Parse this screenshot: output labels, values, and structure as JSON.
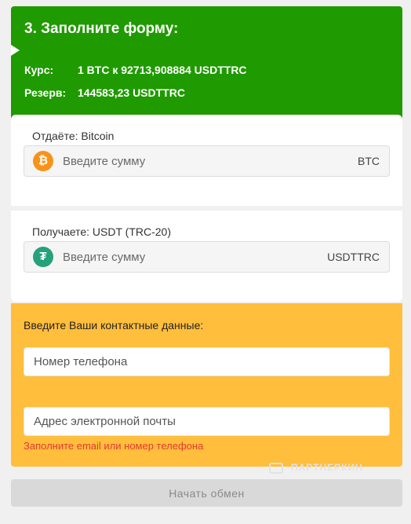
{
  "header": {
    "title": "3. Заполните форму:",
    "rate_label": "Курс:",
    "rate_value": "1 BTC к 92713,908884 USDTTRC",
    "reserve_label": "Резерв:",
    "reserve_value": "144583,23 USDTTRC"
  },
  "give": {
    "label": "Отдаёте: Bitcoin",
    "placeholder": "Введите сумму",
    "currency": "BTC",
    "icon": "bitcoin-icon",
    "icon_glyph": "₿",
    "icon_color": "#f7931a"
  },
  "get": {
    "label": "Получаете: USDT (TRC-20)",
    "placeholder": "Введите сумму",
    "currency": "USDTTRC",
    "icon": "tether-icon",
    "icon_glyph": "₮",
    "icon_color": "#26a17b"
  },
  "contact": {
    "title": "Введите Ваши контактные данные:",
    "phone_placeholder": "Номер телефона",
    "email_placeholder": "Адрес электронной почты",
    "error": "Заполните email или номер телефона"
  },
  "watermark": "ПАРТНЕРКИН",
  "submit": {
    "label": "Начать обмен"
  },
  "colors": {
    "header_bg": "#1f9a00",
    "contact_bg": "#ffbe3c",
    "error": "#e53935",
    "button_disabled": "#d9d9d9"
  }
}
